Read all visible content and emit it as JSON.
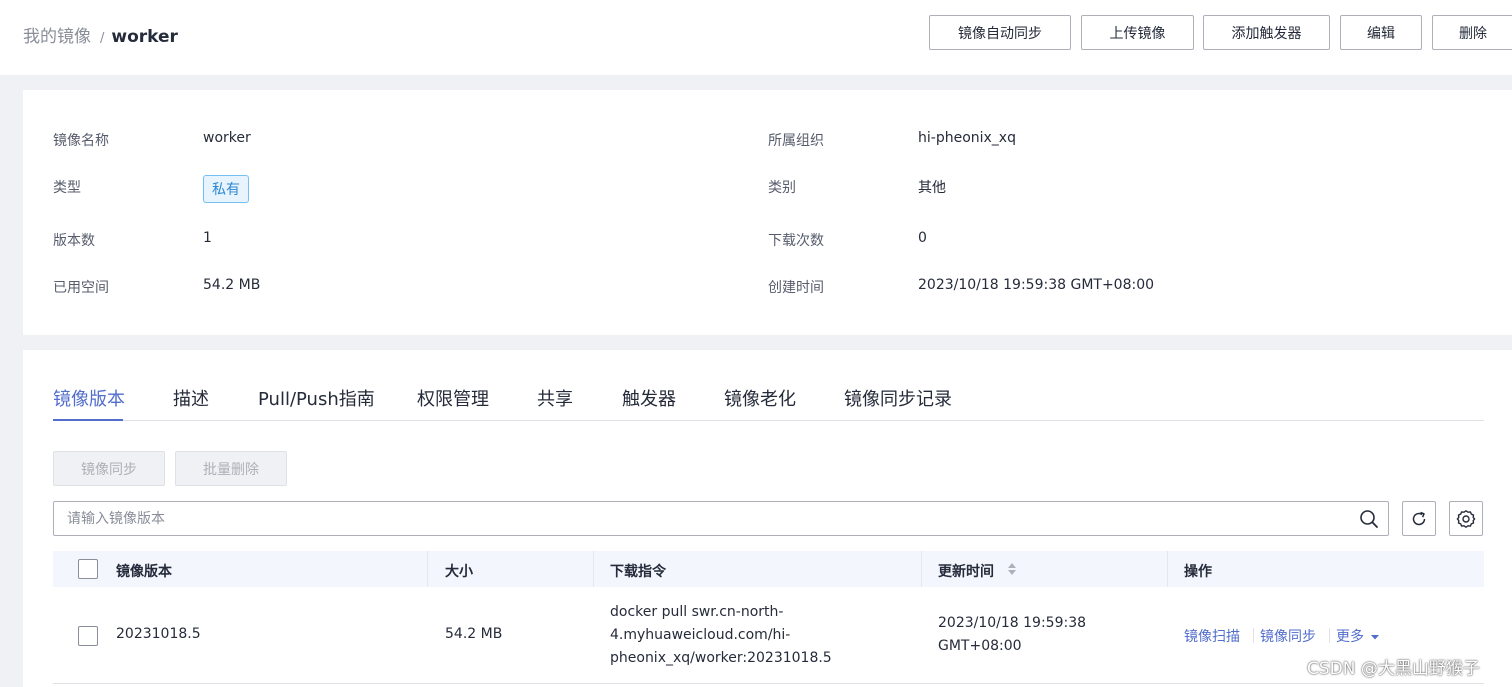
{
  "breadcrumb": {
    "parent": "我的镜像",
    "separator": "/",
    "current": "worker"
  },
  "header_buttons": {
    "auto_sync": "镜像自动同步",
    "upload": "上传镜像",
    "add_trigger": "添加触发器",
    "edit": "编辑",
    "delete": "删除"
  },
  "info": {
    "name_label": "镜像名称",
    "name_value": "worker",
    "org_label": "所属组织",
    "org_value": "hi-pheonix_xq",
    "type_label": "类型",
    "type_value": "私有",
    "category_label": "类别",
    "category_value": "其他",
    "versions_label": "版本数",
    "versions_value": "1",
    "downloads_label": "下载次数",
    "downloads_value": "0",
    "space_label": "已用空间",
    "space_value": "54.2 MB",
    "created_label": "创建时间",
    "created_value": "2023/10/18 19:59:38 GMT+08:00"
  },
  "tabs": [
    "镜像版本",
    "描述",
    "Pull/Push指南",
    "权限管理",
    "共享",
    "触发器",
    "镜像老化",
    "镜像同步记录"
  ],
  "actions": {
    "sync": "镜像同步",
    "batch_delete": "批量删除"
  },
  "search": {
    "placeholder": "请输入镜像版本"
  },
  "table": {
    "columns": [
      "镜像版本",
      "大小",
      "下载指令",
      "更新时间",
      "操作"
    ],
    "rows": [
      {
        "version": "20231018.5",
        "size": "54.2 MB",
        "command_line1": "docker pull swr.cn-north-",
        "command_line2": "4.myhuaweicloud.com/hi-",
        "command_line3": "pheonix_xq/worker:20231018.5",
        "updated_line1": "2023/10/18 19:59:38",
        "updated_line2": "GMT+08:00",
        "op_scan": "镜像扫描",
        "op_sync": "镜像同步",
        "op_more": "更多"
      }
    ]
  },
  "watermark": "CSDN @大黑山野猴子",
  "colors": {
    "accent": "#526ecc",
    "tag_bg": "#e7f4fd",
    "tag_text": "#2e88d2"
  }
}
